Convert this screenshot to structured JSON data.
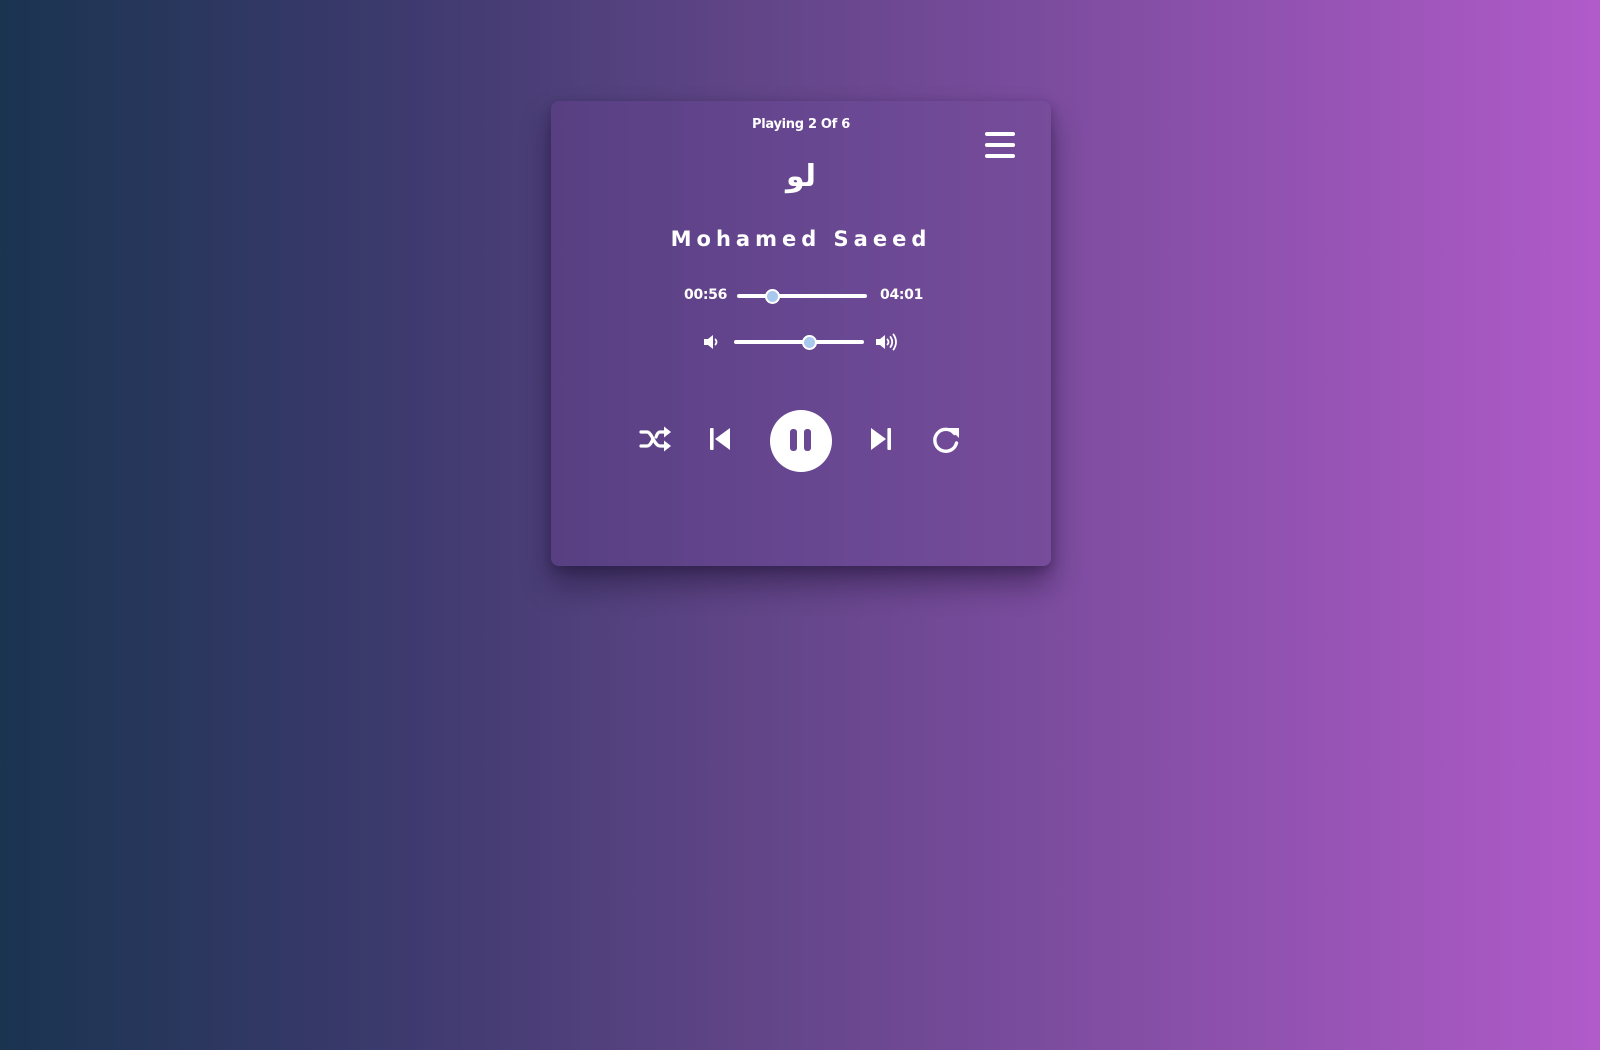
{
  "player": {
    "playing_status": "Playing 2 Of 6",
    "song_title": "لو",
    "artist": "Mohamed Saeed",
    "current_time": "00:56",
    "total_time": "04:01",
    "seek_progress_percent": 27,
    "volume_percent": 58
  },
  "icons": {
    "menu": "menu-icon",
    "volume_down": "volume-down-icon",
    "volume_up": "volume-up-icon",
    "shuffle": "shuffle-icon",
    "previous": "previous-icon",
    "pause": "pause-icon",
    "next": "next-icon",
    "repeat": "repeat-icon"
  },
  "colors": {
    "slider_thumb": "#a9c8ee",
    "card_background": "#6a4893"
  }
}
